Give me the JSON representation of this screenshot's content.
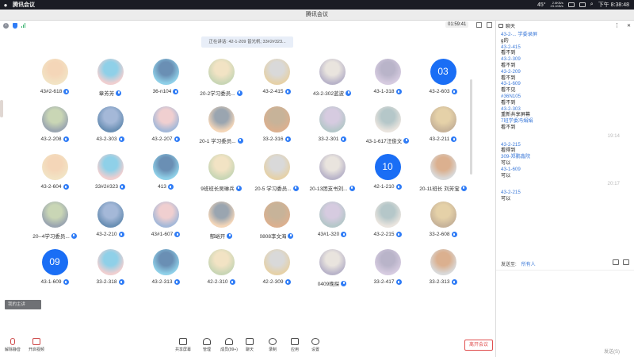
{
  "menubar": {
    "app": "腾讯会议",
    "weather": "45°",
    "net_up": "2.6KB/s",
    "net_down": "23.1KB/s",
    "time": "下午 8:38:48"
  },
  "window": {
    "title": "腾讯会议"
  },
  "meeting": {
    "timer": "01:59:41",
    "speaking": "正在讲话: 42-1-209 皆光帆; 33#2#323...",
    "participants": [
      "43#2-618",
      "章芳芳",
      "36-n104",
      "20-2学习委员...",
      "43-2-415",
      "43-2-302蓝波",
      "43-1-318",
      "43-2-603",
      "43-2-208",
      "43-2-303",
      "43-2-207",
      "20-1 学习委员...",
      "33-2-316",
      "33-2-301",
      "43-1-617汪俊文",
      "43-2-211",
      "43-2-604",
      "33#2#323",
      "413",
      "9班班长吴琳兵",
      "20-5 学习委员...",
      "20-13团支书刘...",
      "42-1-210",
      "20-11班长 刘芳宝",
      "20--4学习委员...",
      "43-2-210",
      "43#1-607",
      "郁峪开",
      "0808李文海",
      "43#1-320",
      "43-2-215",
      "33-2-608",
      "43-1-609",
      "33-2-318",
      "43-2-313",
      "42-2-310",
      "42-2-309",
      "0409晚探",
      "33-2-417",
      "33-2-313"
    ],
    "numbered_avatars": {
      "7": "03",
      "22": "10",
      "32": "09"
    },
    "caption": "我的主讲",
    "colors": {
      "accent": "#1a6ef5",
      "leave": "#e05050"
    }
  },
  "toolbar": {
    "mute": "解除静音",
    "video": "开启视频",
    "share": "共享屏幕",
    "manage": "管理",
    "members": "成员(99+)",
    "chat": "聊天",
    "record": "录制",
    "apps": "应用",
    "settings": "设置",
    "leave": "离开会议"
  },
  "chat": {
    "title": "聊天",
    "messages": [
      {
        "k": "s",
        "t": "43-2-... 学委录屏"
      },
      {
        "k": "b",
        "t": "g的"
      },
      {
        "k": "s",
        "t": "43-2-415"
      },
      {
        "k": "b",
        "t": "看不到"
      },
      {
        "k": "s",
        "t": "43-2-309"
      },
      {
        "k": "b",
        "t": "看不到"
      },
      {
        "k": "s",
        "t": "43-2-209"
      },
      {
        "k": "b",
        "t": "看不到"
      },
      {
        "k": "s",
        "t": "43-1-609"
      },
      {
        "k": "b",
        "t": "看不见"
      },
      {
        "k": "s",
        "t": "#36N105"
      },
      {
        "k": "b",
        "t": "看不到"
      },
      {
        "k": "s",
        "t": "43-2-303"
      },
      {
        "k": "b",
        "t": "重新共享屏幕"
      },
      {
        "k": "s",
        "t": "7班学委冯娟娟"
      },
      {
        "k": "b",
        "t": "看不到"
      },
      {
        "k": "t",
        "t": "19:14"
      },
      {
        "k": "s",
        "t": "43-2-215"
      },
      {
        "k": "b",
        "t": "看得到"
      },
      {
        "k": "s",
        "t": "309-郑鹏鑫院"
      },
      {
        "k": "b",
        "t": "可以"
      },
      {
        "k": "s",
        "t": "43-1-609"
      },
      {
        "k": "b",
        "t": "可以"
      },
      {
        "k": "t",
        "t": "20:17"
      },
      {
        "k": "s",
        "t": "43-2-215"
      },
      {
        "k": "b",
        "t": "可以"
      }
    ],
    "send_to_label": "发送至:",
    "send_to_value": "所有人",
    "send_button": "发送(S)"
  }
}
